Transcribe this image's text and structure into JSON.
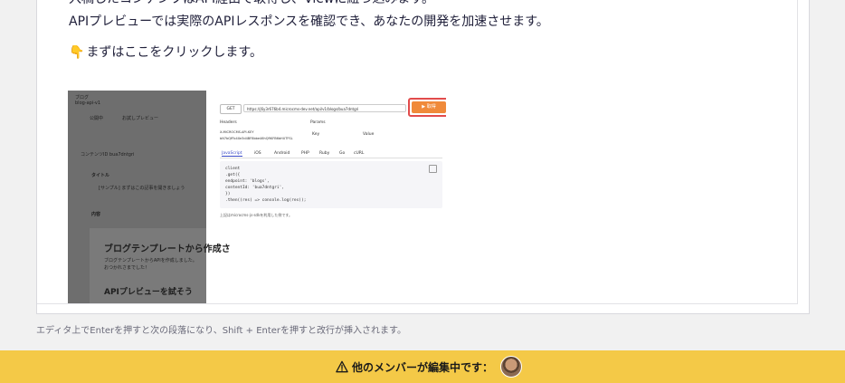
{
  "editor": {
    "paragraph1": "入稿したコンテンツはAPI経由で取得し、Viewに紐づ込みます。",
    "paragraph2": "APIプレビューでは実際のAPIレスポンスを確認でき、あなたの開発を加速させます。",
    "paragraph3_icon": "pointing-down-hand-icon",
    "paragraph3": "まずはここをクリックします。"
  },
  "embedded_screenshot": {
    "left_panel": {
      "app_title": "ブログ",
      "app_sub": "blog-api-v1",
      "status_public": "公開中",
      "status_draft": "お試しプレビュー",
      "content_id": "コンテンツID  bua7dntgri",
      "title_label": "タイトル",
      "title_value": "[サンプル] まずはこの記事を開きましょう",
      "body_label": "内容",
      "heading1": "ブログテンプレートから作成さ",
      "body_text1": "ブログテンプレートからAPIを作成しました。",
      "body_text2": "おつかれさまでした！",
      "heading2": "APIプレビューを試そう"
    },
    "right_panel": {
      "method": "GET",
      "url": "https://j6y3r676b4.microcms-dev.net/api/v1/blogs/bua7dntgri",
      "send_label": "▶ 取得",
      "headers_label": "Headers",
      "params_label": "Params",
      "api_key_label": "X-MICROCMS-API-KEY",
      "api_key_value": "bN7bQfFb4Xe3d4BF8bbe46hQRKFB6bHUTFSL",
      "key_placeholder": "Key",
      "value_placeholder": "Value",
      "tabs": [
        "JavaScript",
        "iOS",
        "Android",
        "PHP",
        "Ruby",
        "Go",
        "cURL"
      ],
      "code_lines": [
        "client",
        "  .get({",
        "    endpoint: 'blogs',",
        "    contentId: 'bua7dntgri',",
        "  })",
        "  .then((res) => console.log(res));"
      ],
      "footnote": "上記はmicrocms-js-sdkを利用した例です。"
    }
  },
  "hint": "エディタ上でEnterを押すと次の段落になり、Shift + Enterを押すと改行が挿入されます。",
  "banner": {
    "icon": "warning-icon",
    "text": "他のメンバーが編集中です：",
    "color": "#f4c947"
  }
}
